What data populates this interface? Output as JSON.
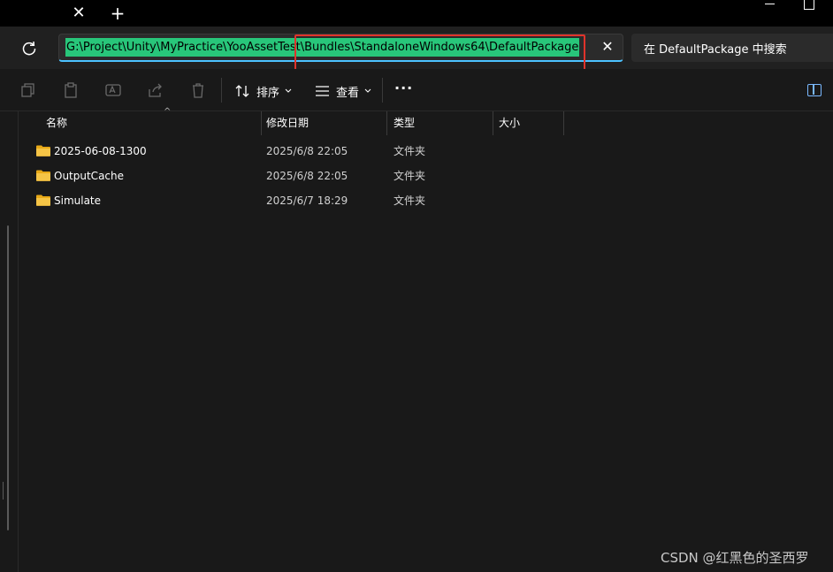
{
  "titlebar": {
    "new_tab_label": "+",
    "tab_close_label": "✕"
  },
  "address": {
    "path": "G:\\Project\\Unity\\MyPractice\\YooAssetTest\\Bundles\\StandaloneWindows64\\DefaultPackage",
    "clear_label": "✕",
    "search_placeholder": "在 DefaultPackage 中搜索"
  },
  "command_bar": {
    "sort_label": "排序",
    "view_label": "查看",
    "more_label": "···"
  },
  "columns": [
    {
      "label": "名称"
    },
    {
      "label": "修改日期"
    },
    {
      "label": "类型"
    },
    {
      "label": "大小"
    }
  ],
  "files": [
    {
      "name": "2025-06-08-1300",
      "modified": "2025/6/8 22:05",
      "type": "文件夹",
      "size": ""
    },
    {
      "name": "OutputCache",
      "modified": "2025/6/8 22:05",
      "type": "文件夹",
      "size": ""
    },
    {
      "name": "Simulate",
      "modified": "2025/6/7 18:29",
      "type": "文件夹",
      "size": ""
    }
  ],
  "watermark": "CSDN @红黑色的圣西罗",
  "colors": {
    "selection": "#28c67a",
    "highlight_border": "#e0332b",
    "folder": "#f5c446",
    "accent": "#4cc2ff"
  }
}
